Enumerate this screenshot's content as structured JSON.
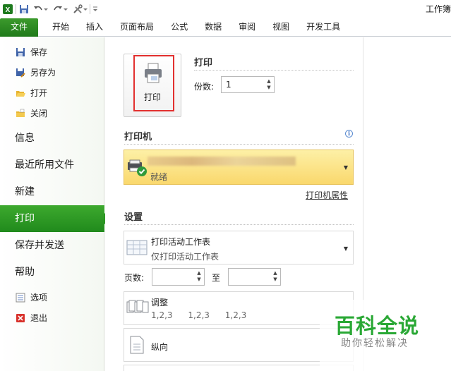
{
  "window": {
    "title": "工作簿"
  },
  "ribbon_tabs": [
    "文件",
    "开始",
    "插入",
    "页面布局",
    "公式",
    "数据",
    "审阅",
    "视图",
    "开发工具"
  ],
  "nav": {
    "small_items_top": [
      {
        "label": "保存",
        "icon": "save-icon"
      },
      {
        "label": "另存为",
        "icon": "save-as-icon"
      },
      {
        "label": "打开",
        "icon": "open-folder-icon"
      },
      {
        "label": "关闭",
        "icon": "close-folder-icon"
      }
    ],
    "big_items": [
      "信息",
      "最近所用文件",
      "新建",
      "打印",
      "保存并发送",
      "帮助"
    ],
    "active": "打印",
    "small_items_bottom": [
      {
        "label": "选项",
        "icon": "options-icon"
      },
      {
        "label": "退出",
        "icon": "exit-icon"
      }
    ]
  },
  "print": {
    "section_title": "打印",
    "button_label": "打印",
    "copies_label": "份数:",
    "copies_value": "1"
  },
  "printer": {
    "section_title": "打印机",
    "status": "就绪",
    "properties_link": "打印机属性"
  },
  "settings": {
    "section_title": "设置",
    "scope": {
      "title": "打印活动工作表",
      "subtitle": "仅打印活动工作表"
    },
    "pages_label": "页数:",
    "to_label": "至",
    "collate": {
      "title": "调整",
      "values": [
        "1,2,3",
        "1,2,3",
        "1,2,3"
      ]
    },
    "orientation": {
      "title": "纵向"
    }
  },
  "watermark": {
    "title": "百科全说",
    "subtitle": "助你轻松解决"
  },
  "colors": {
    "accent_green": "#2a9422",
    "highlight_red": "#e2302f",
    "printer_yellow": "#fad86d"
  }
}
